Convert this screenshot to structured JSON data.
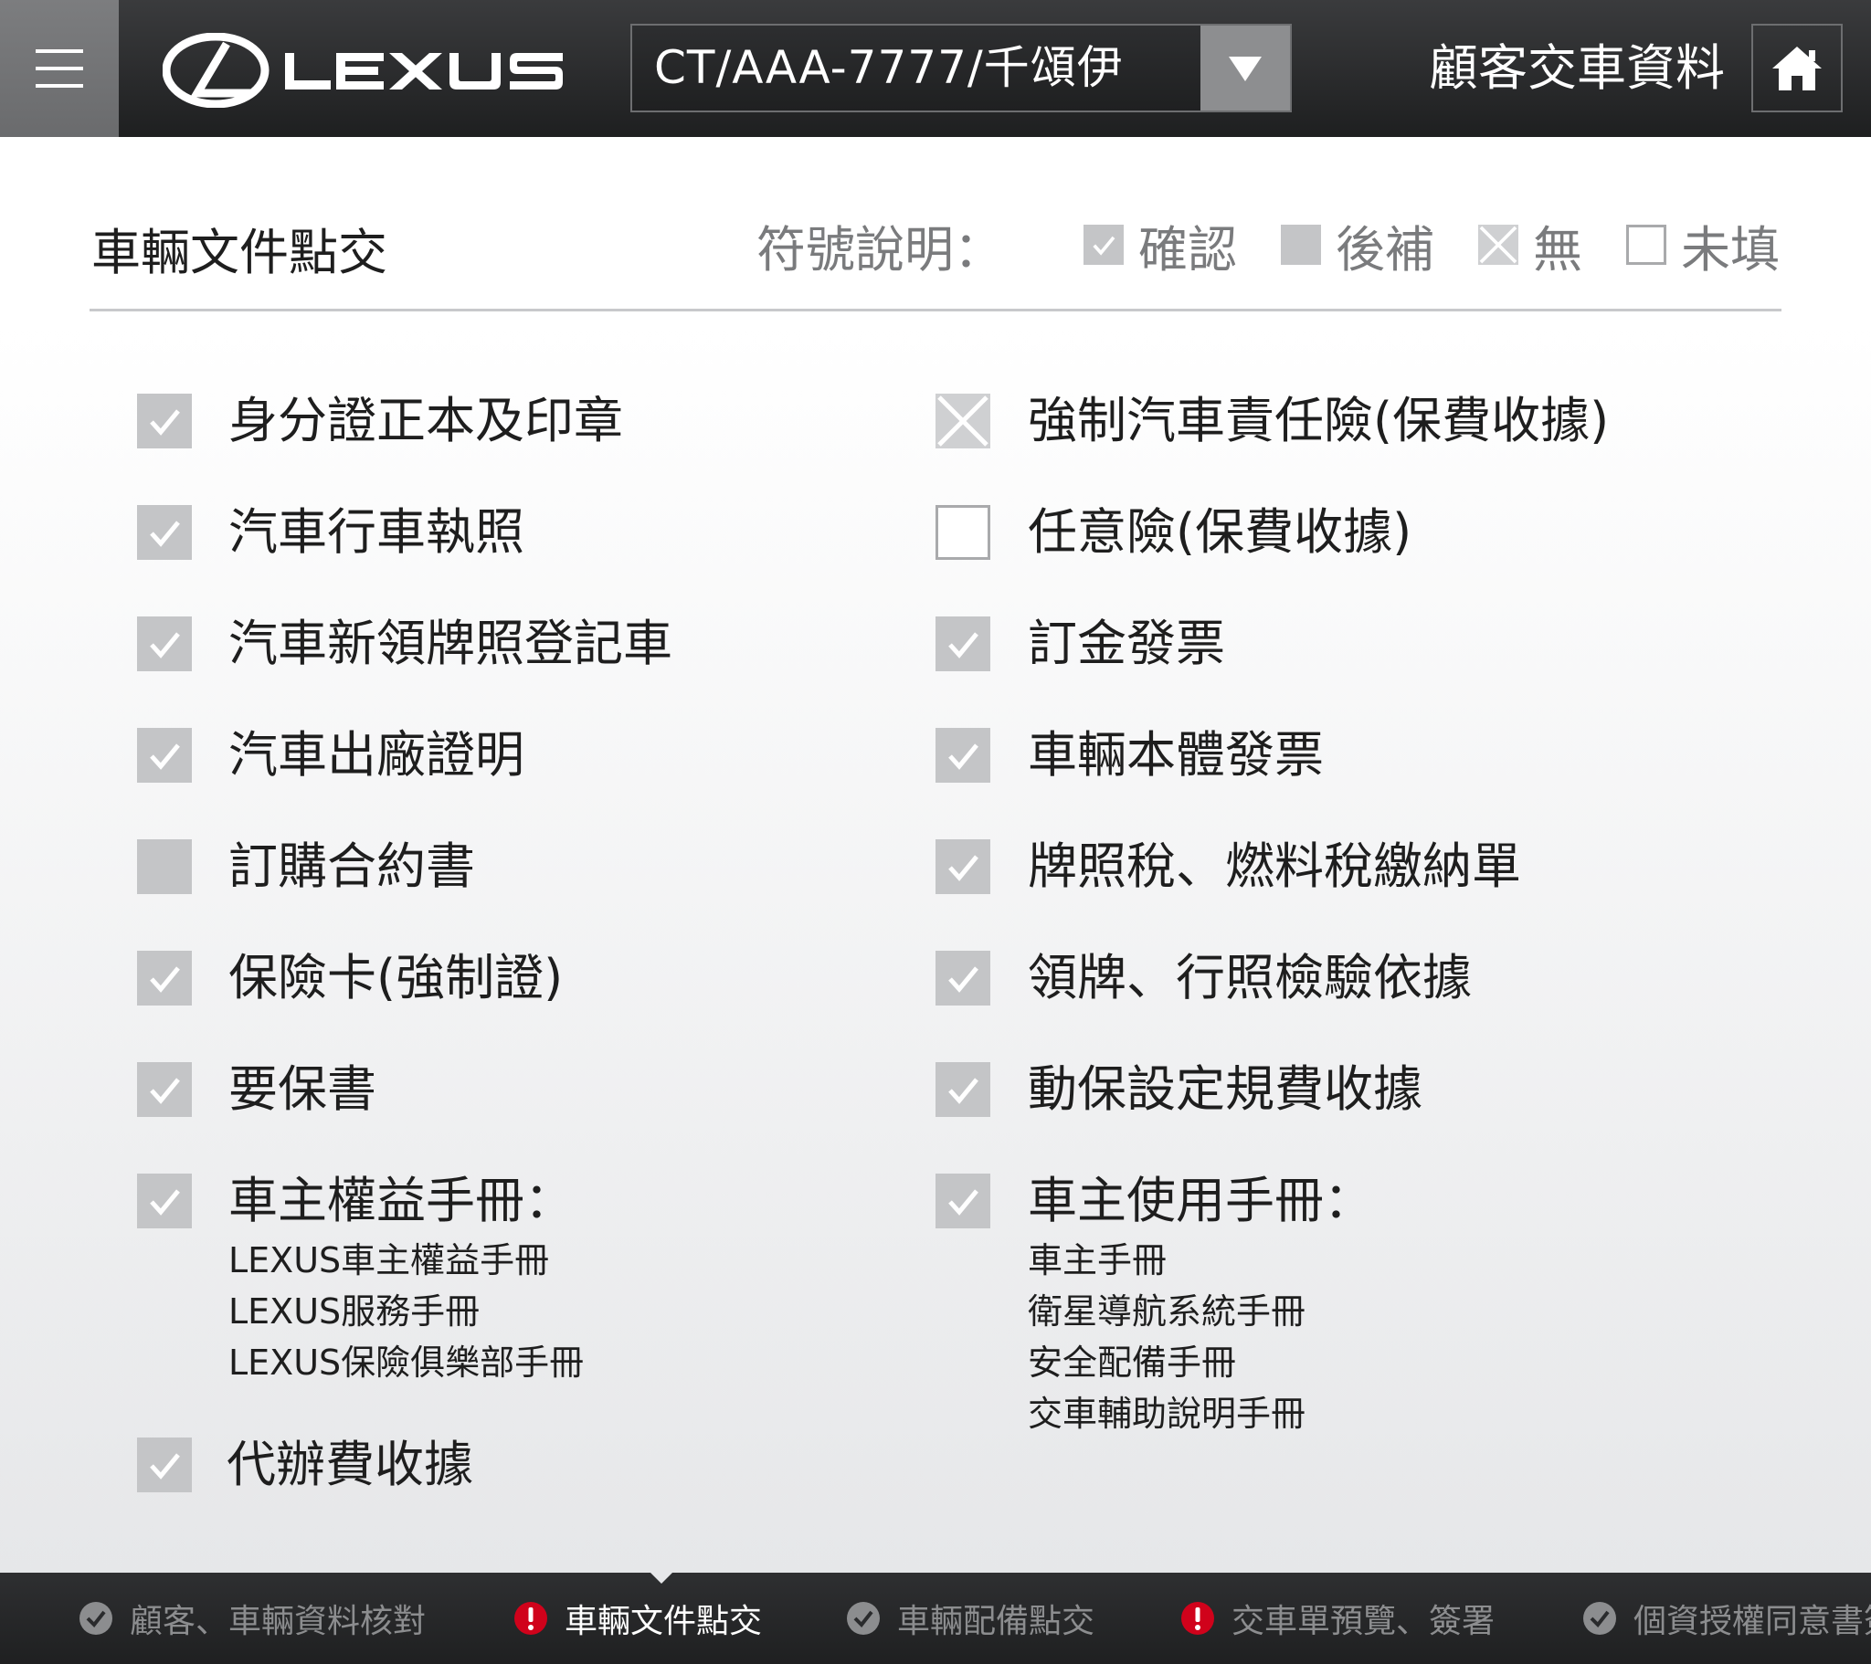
{
  "header": {
    "brand": "LEXUS",
    "vehicle_selector": "CT/AAA-7777/千頌伊",
    "page_title": "顧客交車資料"
  },
  "section": {
    "title": "車輛文件點交",
    "legend_title": "符號說明：",
    "legend": [
      {
        "state": "confirm",
        "label": "確認"
      },
      {
        "state": "later",
        "label": "後補"
      },
      {
        "state": "none",
        "label": "無"
      },
      {
        "state": "empty",
        "label": "未填"
      }
    ]
  },
  "documents": {
    "left": [
      {
        "label": "身分證正本及印章",
        "state": "confirm",
        "sub": []
      },
      {
        "label": "汽車行車執照",
        "state": "confirm",
        "sub": []
      },
      {
        "label": "汽車新領牌照登記車",
        "state": "confirm",
        "sub": []
      },
      {
        "label": "汽車出廠證明",
        "state": "confirm",
        "sub": []
      },
      {
        "label": "訂購合約書",
        "state": "later",
        "sub": []
      },
      {
        "label": "保險卡(強制證)",
        "state": "confirm",
        "sub": []
      },
      {
        "label": "要保書",
        "state": "confirm",
        "sub": []
      },
      {
        "label": "車主權益手冊：",
        "state": "confirm",
        "sub": [
          "LEXUS車主權益手冊",
          "LEXUS服務手冊",
          "LEXUS保險俱樂部手冊"
        ]
      },
      {
        "label": "代辦費收據",
        "state": "confirm",
        "sub": []
      }
    ],
    "right": [
      {
        "label": "強制汽車責任險(保費收據)",
        "state": "none",
        "sub": []
      },
      {
        "label": "任意險(保費收據)",
        "state": "empty",
        "sub": []
      },
      {
        "label": "訂金發票",
        "state": "confirm",
        "sub": []
      },
      {
        "label": "車輛本體發票",
        "state": "confirm",
        "sub": []
      },
      {
        "label": "牌照稅、燃料稅繳納單",
        "state": "confirm",
        "sub": []
      },
      {
        "label": "領牌、行照檢驗依據",
        "state": "confirm",
        "sub": []
      },
      {
        "label": "動保設定規費收據",
        "state": "confirm",
        "sub": []
      },
      {
        "label": "車主使用手冊：",
        "state": "confirm",
        "sub": [
          "車主手冊",
          "衛星導航系統手冊",
          "安全配備手冊",
          "交車輔助說明手冊"
        ]
      }
    ]
  },
  "steps": [
    {
      "label": "顧客、車輛資料核對",
      "status": "done"
    },
    {
      "label": "車輛文件點交",
      "status": "warning",
      "active": true
    },
    {
      "label": "車輛配備點交",
      "status": "done"
    },
    {
      "label": "交車單預覽、簽署",
      "status": "warning"
    },
    {
      "label": "個資授權同意書簽署",
      "status": "done"
    }
  ],
  "colors": {
    "header_bg": "#2a2b2d",
    "checkbox_fill": "#c4c5c7",
    "warning_red": "#d0021b",
    "text": "#1e1e1e"
  },
  "icons": {
    "menu": "hamburger-icon",
    "dropdown": "triangle-down-icon",
    "home": "home-icon",
    "confirm": "checkmark-icon",
    "none": "cross-icon",
    "step_done": "check-circle-icon",
    "step_warning": "exclamation-circle-icon"
  }
}
